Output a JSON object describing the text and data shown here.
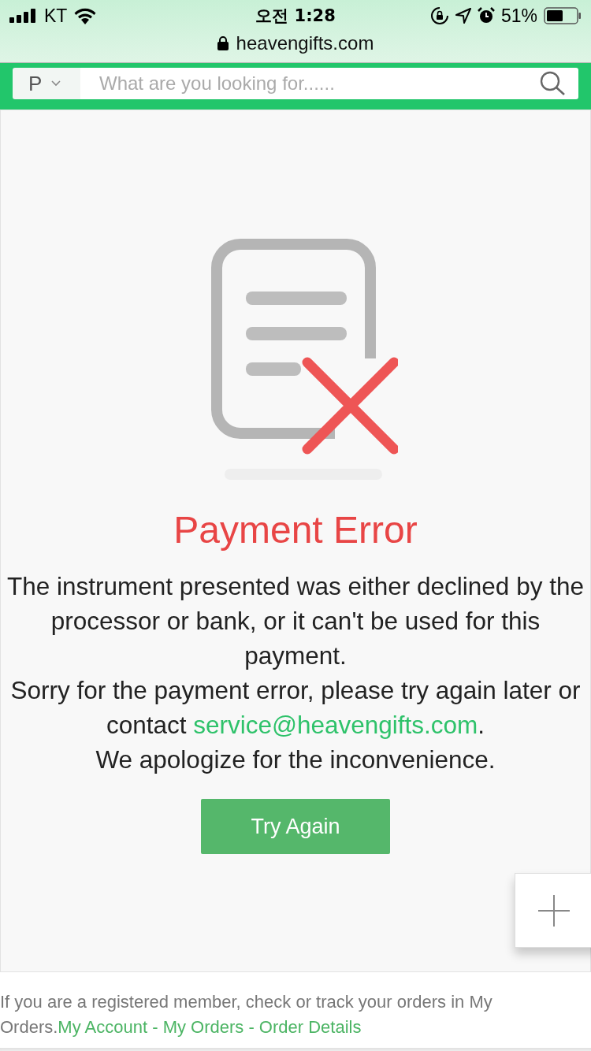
{
  "status_bar": {
    "carrier": "KT",
    "time": "오전 1:28",
    "battery": "51%"
  },
  "url_bar": {
    "url": "heavengifts.com"
  },
  "search": {
    "category": "P",
    "placeholder": "What are you looking for......"
  },
  "error": {
    "title": "Payment Error",
    "message": "The instrument presented was either declined by the processor or bank, or it can't be used for this payment.",
    "apology_text": "Sorry for the payment error, please try again later or contact ",
    "email": "service@heavengifts.com",
    "apology_end": ".",
    "closing": "We apologize for the inconvenience.",
    "button": "Try Again"
  },
  "footer": {
    "text": "If you are a registered member, check or track your orders in My Orders.",
    "link": "My Account - My Orders - Order Details"
  }
}
